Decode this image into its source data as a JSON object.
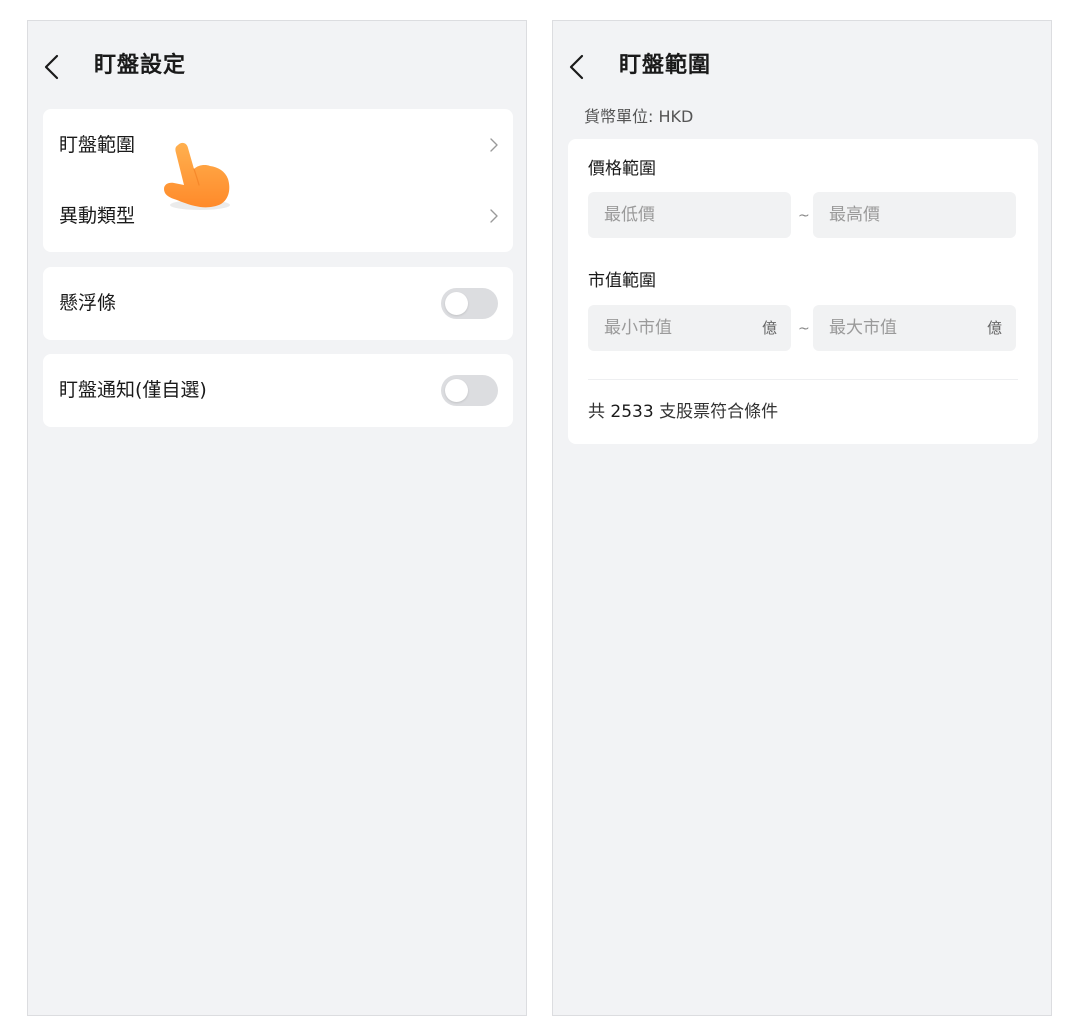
{
  "left_screen": {
    "title": "盯盤設定",
    "menu_items": [
      {
        "label": "盯盤範圍"
      },
      {
        "label": "異動類型"
      }
    ],
    "floating_bar": {
      "label": "懸浮條",
      "enabled": false
    },
    "watch_notify": {
      "label": "盯盤通知(僅自選)",
      "enabled": false
    }
  },
  "right_screen": {
    "title": "盯盤範圍",
    "currency_label": "貨幣單位: HKD",
    "price_range": {
      "label": "價格範圍",
      "min_placeholder": "最低價",
      "max_placeholder": "最高價",
      "separator": "~"
    },
    "market_cap_range": {
      "label": "市值範圍",
      "min_placeholder": "最小市值",
      "max_placeholder": "最大市值",
      "unit": "億",
      "separator": "~"
    },
    "summary": {
      "prefix": "共",
      "count": "2533",
      "suffix": "支股票符合條件"
    }
  },
  "colors": {
    "background": "#f2f3f5",
    "card": "#ffffff",
    "toggle_off": "#dcdde0",
    "pointer_hand": "#ff9a3c"
  },
  "icons": [
    "back-icon",
    "chevron-right-icon",
    "pointer-hand-icon"
  ]
}
